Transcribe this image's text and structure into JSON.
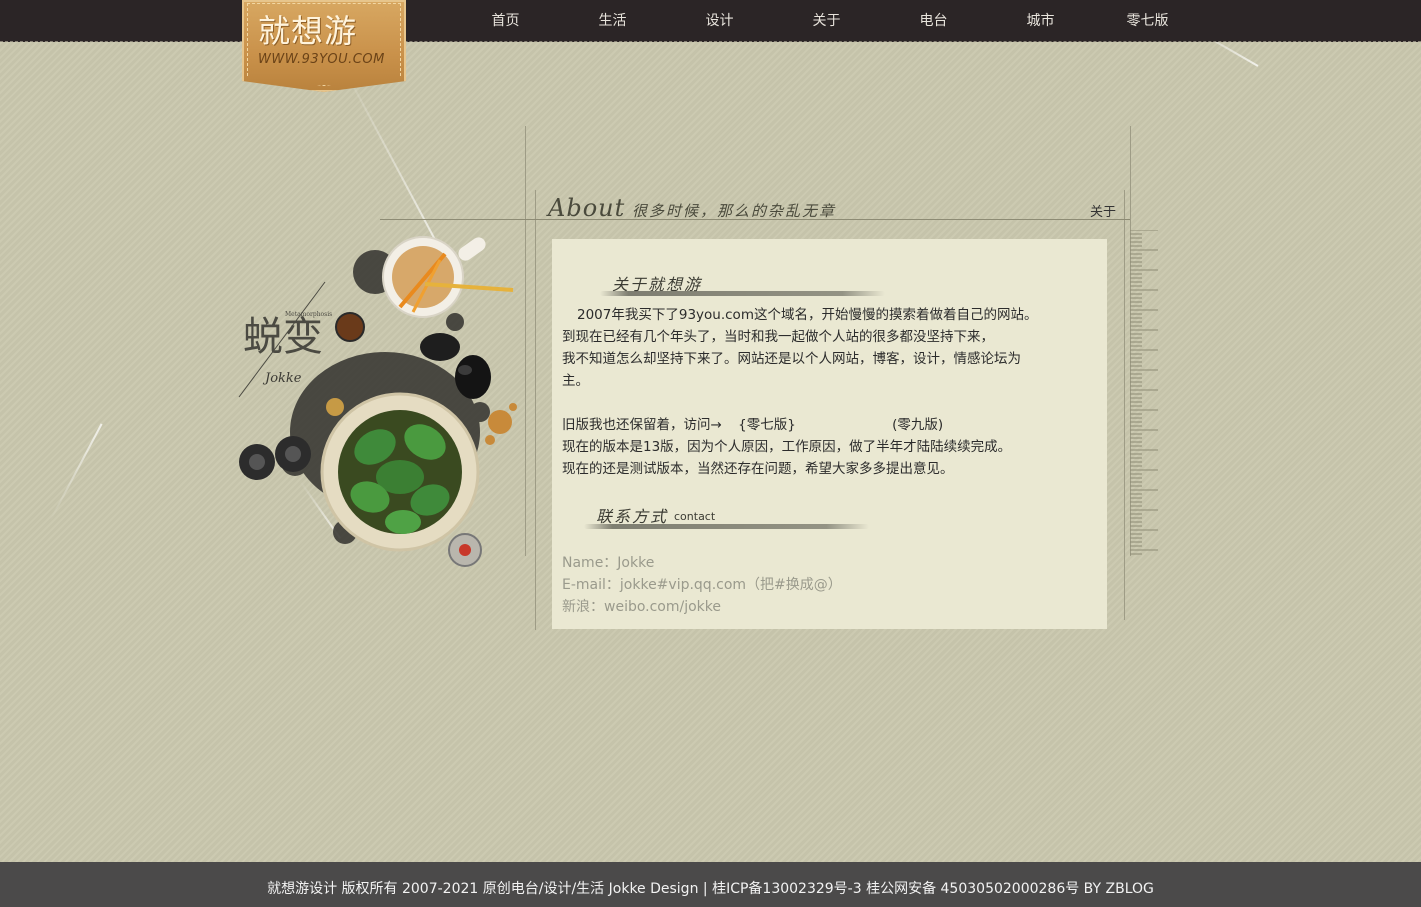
{
  "header": {
    "logo_title": "就想游",
    "logo_url": "WWW.93YOU.COM",
    "nav": [
      "首页",
      "生活",
      "设计",
      "关于",
      "电台",
      "城市",
      "零七版"
    ]
  },
  "collage": {
    "title": "蜕变",
    "subtitle": "Metamorphosis",
    "signature": "Jokke"
  },
  "about_header": {
    "title_en": "About",
    "title_cn": "很多时候，那么的杂乱无章",
    "corner_label": "关于"
  },
  "about": {
    "heading": "关于就想游",
    "lines": [
      "2007年我买下了93you.com这个域名，开始慢慢的摸索着做着自己的网站。",
      "到现在已经有几个年头了，当时和我一起做个人站的很多都没坚持下来，",
      "我不知道怎么却坚持下来了。网站还是以个人网站，博客，设计，情感论坛为",
      "主。"
    ],
    "old_version_prefix": "旧版我也还保留着，访问→",
    "old_version_link_1": "{零七版}",
    "old_version_link_2": "(零九版)",
    "lines2": [
      "现在的版本是13版，因为个人原因，工作原因，做了半年才陆陆续续完成。",
      "现在的还是测试版本，当然还存在问题，希望大家多多提出意见。"
    ]
  },
  "contact": {
    "heading": "联系方式",
    "heading_en": "contact",
    "name": "Name：Jokke",
    "email": "E-mail：jokke#vip.qq.com（把#换成@）",
    "weibo": "新浪：weibo.com/jokke"
  },
  "footer": {
    "text": "就想游设计 版权所有 2007-2021 原创电台/设计/生活 Jokke Design |     桂ICP备13002329号-3 桂公网安备 45030502000286号 BY ZBLOG"
  }
}
